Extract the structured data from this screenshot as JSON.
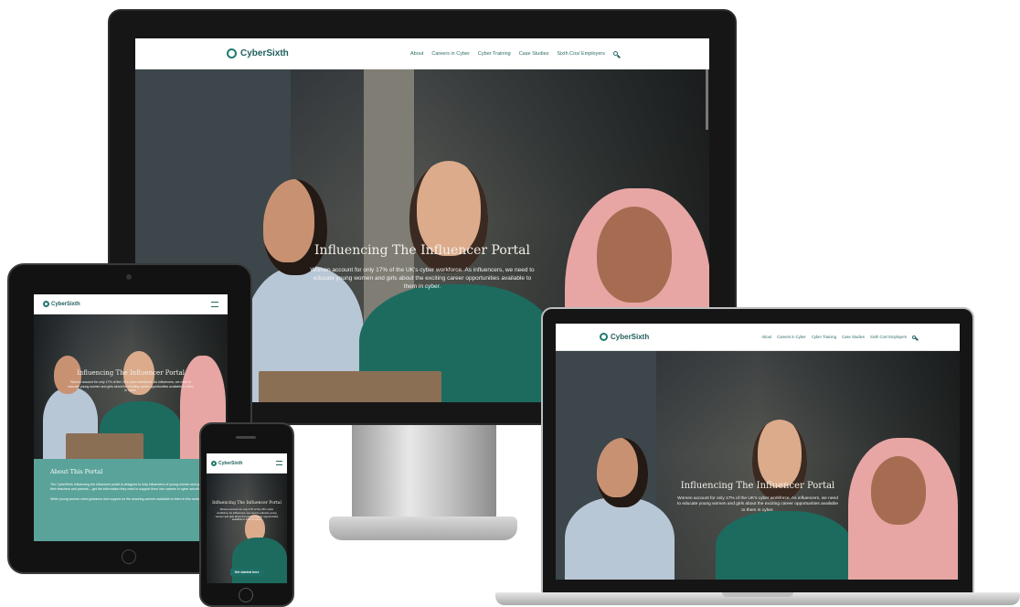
{
  "site": {
    "logo_text": "CyberSixth",
    "nav": [
      "About",
      "Careers in Cyber",
      "Cyber Training",
      "Case Studies",
      "Sixth Cos/ Employers"
    ],
    "hero_title": "Influencing The Influencer Portal",
    "hero_desc": "Women account for only 17% of the UK's cyber workforce. As influencers, we need to educate young women and girls about the exciting career opportunities available to them in cyber.",
    "about_heading": "About This Portal",
    "about_text_1": "The CyberSixth Influencing the Influencer portal is designed to help influencers of young women and girls – their teachers and parents – get the information they need to support them into careers in cyber security.",
    "about_text_2": "While young women need guidance and support on the amazing careers available to them in this sector...",
    "cta_label": "Get started here"
  },
  "colors": {
    "brand_teal": "#1f6f66",
    "about_panel": "#5aa39a",
    "device_frame": "#1a1a1a",
    "silver": "#c9c9c9"
  }
}
